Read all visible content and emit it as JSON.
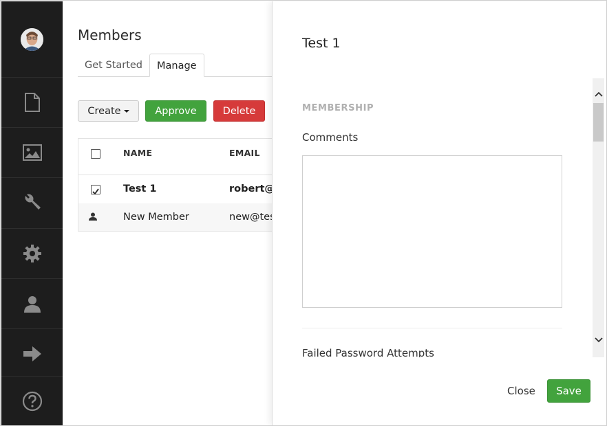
{
  "sidebar": {
    "avatar_alt": "User avatar",
    "items": [
      {
        "icon": "document-icon"
      },
      {
        "icon": "image-icon"
      },
      {
        "icon": "wrench-icon"
      },
      {
        "icon": "gear-icon"
      },
      {
        "icon": "user-icon"
      },
      {
        "icon": "arrow-right-icon"
      },
      {
        "icon": "help-icon"
      }
    ]
  },
  "main": {
    "title": "Members",
    "tabs": [
      {
        "label": "Get Started",
        "active": false
      },
      {
        "label": "Manage",
        "active": true
      }
    ],
    "toolbar": {
      "create_label": "Create",
      "approve_label": "Approve",
      "delete_label": "Delete"
    },
    "table": {
      "columns": [
        "NAME",
        "EMAIL"
      ],
      "rows": [
        {
          "name": "Test 1",
          "email": "robert@",
          "checked": true,
          "bold": true
        },
        {
          "name": "New Member",
          "email": "new@tes",
          "checked": false,
          "icon": "user-icon"
        }
      ]
    }
  },
  "panel": {
    "title": "Test 1",
    "section_title": "MEMBERSHIP",
    "comments_label": "Comments",
    "comments_value": "",
    "failed_label": "Failed Password Attempts",
    "close_label": "Close",
    "save_label": "Save"
  },
  "colors": {
    "sidebar_bg": "#1d1d1d",
    "green": "#42a33d",
    "red": "#d63a3a"
  }
}
